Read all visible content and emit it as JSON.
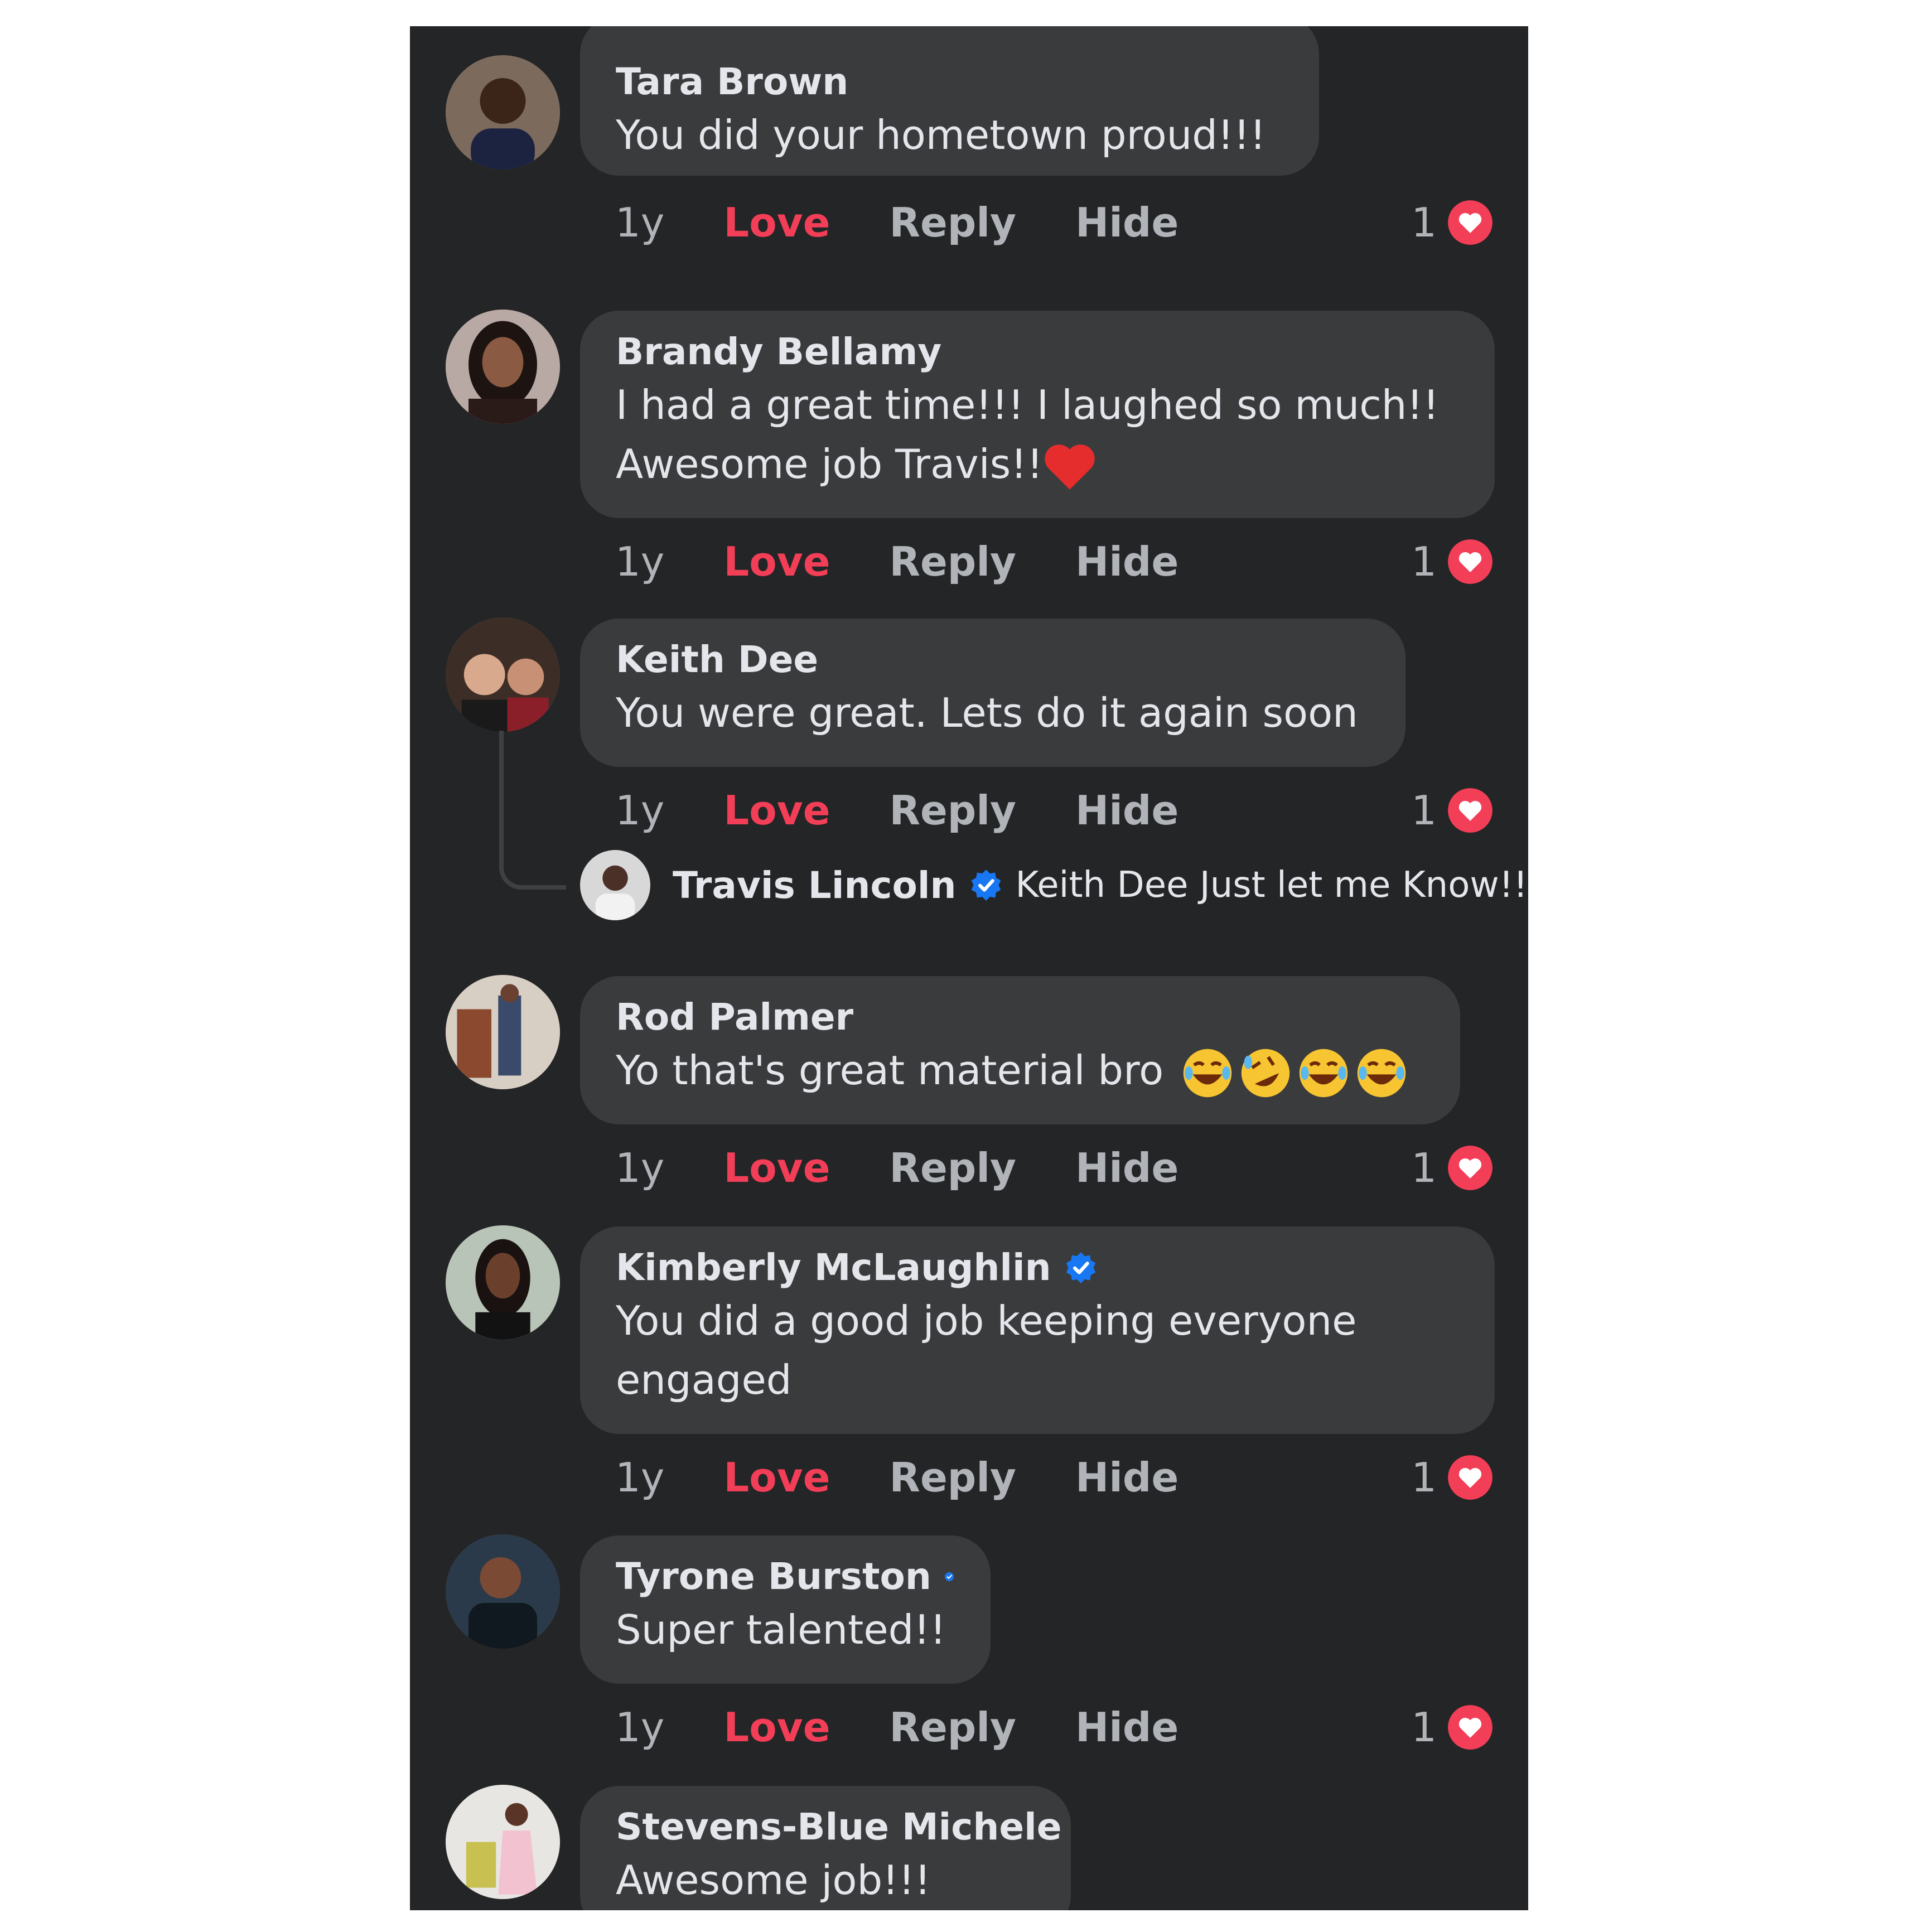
{
  "colors": {
    "panel_bg": "#242526",
    "bubble_bg": "#3a3b3c",
    "love": "#f33e58",
    "verified": "#1877f2"
  },
  "comments": [
    {
      "author": "Tara Brown",
      "verified": false,
      "text": [
        "You did your hometown proud!!!"
      ],
      "time": "1y",
      "love": "Love",
      "reply": "Reply",
      "hide": "Hide",
      "reaction_count": "1",
      "reaction_icon": "heart-icon",
      "avatar_icon": "profile-photo"
    },
    {
      "author": "Brandy Bellamy",
      "verified": false,
      "text": [
        "I had a great time!!! I laughed so much!!",
        "Awesome job Travis!!"
      ],
      "emoji": "red-heart-emoji",
      "time": "1y",
      "love": "Love",
      "reply": "Reply",
      "hide": "Hide",
      "reaction_count": "1",
      "reaction_icon": "heart-icon",
      "avatar_icon": "profile-photo"
    },
    {
      "author": "Keith Dee",
      "verified": false,
      "text": [
        "You were great. Lets do it again soon"
      ],
      "time": "1y",
      "love": "Love",
      "reply": "Reply",
      "hide": "Hide",
      "reaction_count": "1",
      "reaction_icon": "heart-icon",
      "avatar_icon": "profile-photo"
    },
    {
      "author": "Rod Palmer",
      "verified": false,
      "text": [
        "Yo that's great material bro "
      ],
      "emoji": "laughing-emojis",
      "time": "1y",
      "love": "Love",
      "reply": "Reply",
      "hide": "Hide",
      "reaction_count": "1",
      "reaction_icon": "heart-icon",
      "avatar_icon": "profile-photo"
    },
    {
      "author": "Kimberly McLaughlin",
      "verified": true,
      "text": [
        "You did a good job keeping everyone",
        "engaged"
      ],
      "time": "1y",
      "love": "Love",
      "reply": "Reply",
      "hide": "Hide",
      "reaction_count": "1",
      "reaction_icon": "heart-icon",
      "avatar_icon": "profile-photo"
    },
    {
      "author": "Tyrone Burston",
      "verified": true,
      "text": [
        "Super talented!!"
      ],
      "time": "1y",
      "love": "Love",
      "reply": "Reply",
      "hide": "Hide",
      "reaction_count": "1",
      "reaction_icon": "heart-icon",
      "avatar_icon": "profile-photo"
    },
    {
      "author": "Stevens-Blue Michele",
      "verified": false,
      "text": [
        "Awesome job!!!"
      ],
      "avatar_icon": "profile-photo"
    }
  ],
  "reply": {
    "author": "Travis Lincoln",
    "verified": true,
    "text": "Keith Dee Just let me Know!!!",
    "avatar_icon": "profile-photo"
  }
}
